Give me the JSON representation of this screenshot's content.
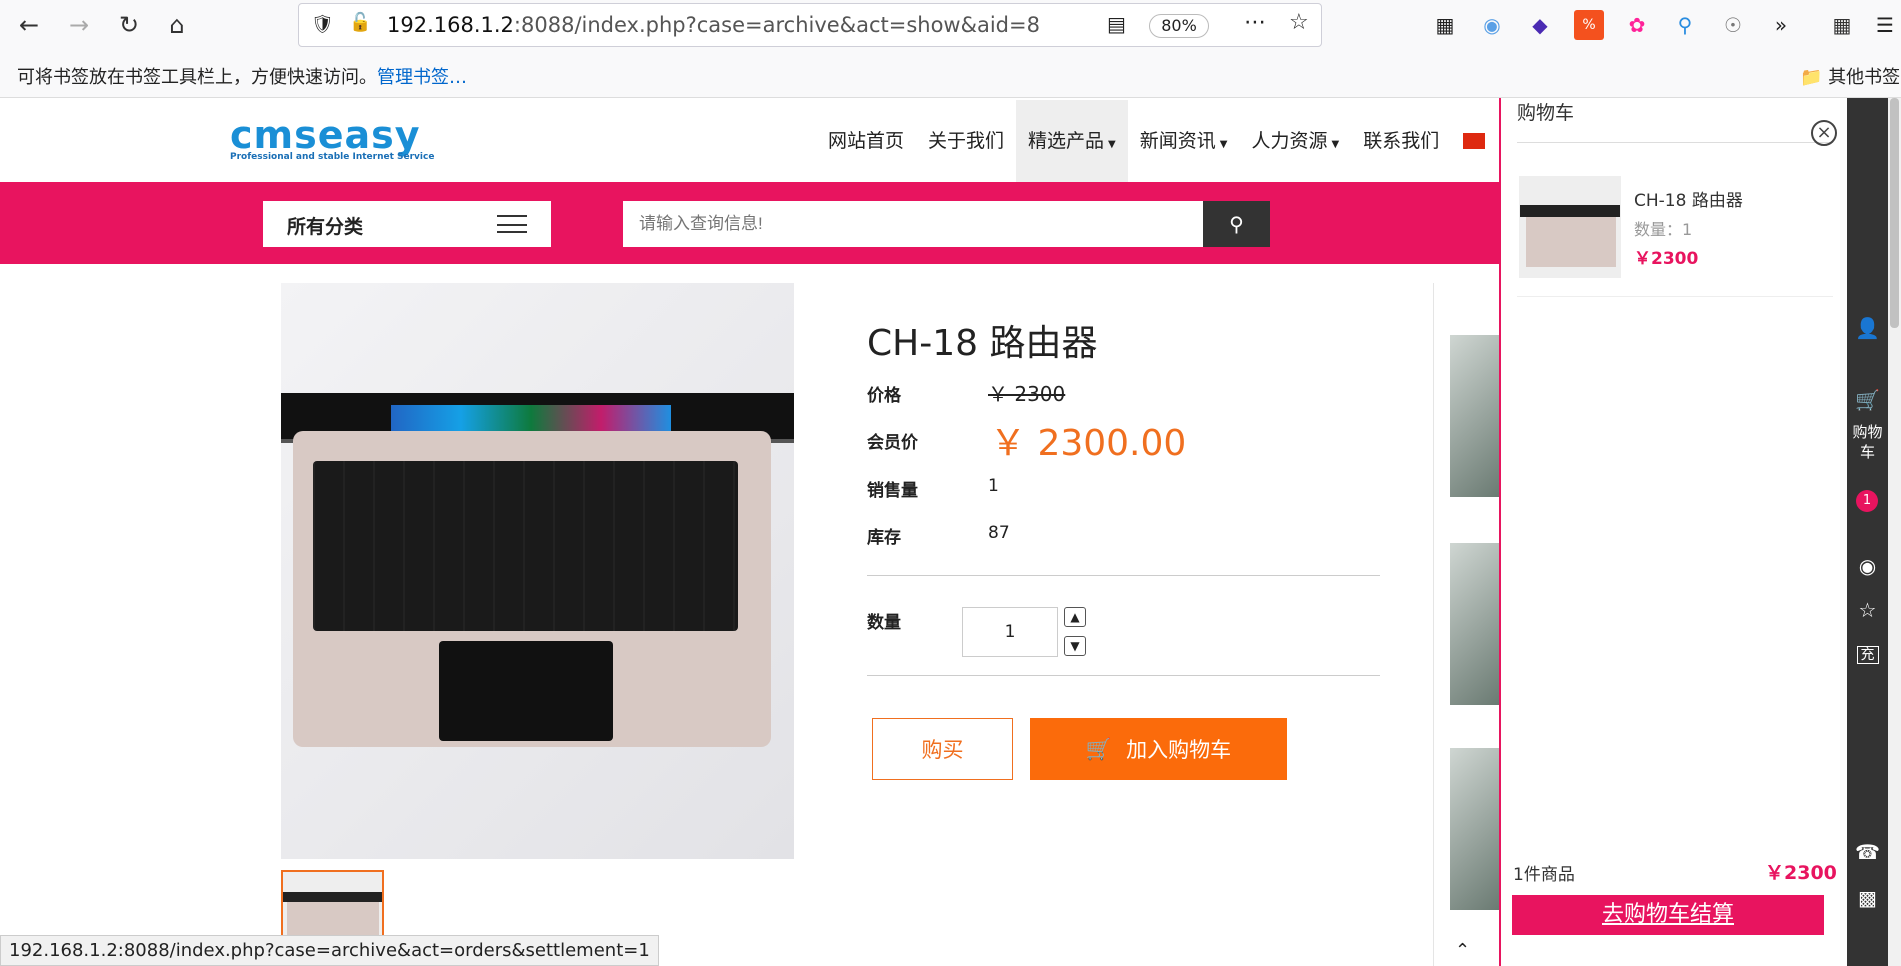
{
  "browser": {
    "url_host": "192.168.1.2",
    "url_rest": ":8088/index.php?case=archive&act=show&aid=8",
    "zoom": "80%",
    "bookmarks_hint": "可将书签放在书签工具栏上，方便快速访问。",
    "bookmarks_manage": "管理书签…",
    "other_bookmarks": "其他书签",
    "status_url": "192.168.1.2:8088/index.php?case=archive&act=orders&settlement=1"
  },
  "site": {
    "logo_main": "cmseasy",
    "logo_sub": "Professional and stable Internet Service",
    "nav": [
      {
        "label": "网站首页",
        "dropdown": false
      },
      {
        "label": "关于我们",
        "dropdown": false
      },
      {
        "label": "精选产品",
        "dropdown": true
      },
      {
        "label": "新闻资讯",
        "dropdown": true
      },
      {
        "label": "人力资源",
        "dropdown": true
      },
      {
        "label": "联系我们",
        "dropdown": false
      }
    ],
    "category_label": "所有分类",
    "search_placeholder": "请输入查询信息!"
  },
  "product": {
    "title": "CH-18 路由器",
    "price_label": "价格",
    "price_value": "￥ 2300",
    "member_label": "会员价",
    "member_value": "￥ 2300.00",
    "sales_label": "销售量",
    "sales_value": "1",
    "stock_label": "库存",
    "stock_value": "87",
    "qty_label": "数量",
    "qty_value": "1",
    "buy_label": "购买",
    "add_cart_label": "加入购物车"
  },
  "cart": {
    "title": "购物车",
    "item_name": "CH-18 路由器",
    "item_qty": "数量：1",
    "item_price": "￥2300",
    "total_count": "1件商品",
    "total_price": "￥2300",
    "checkout_label": "去购物车结算"
  },
  "rail": {
    "cart_label": "购物车",
    "badge": "1",
    "recharge": "充"
  },
  "colors": {
    "brand_pink": "#e8145f",
    "accent_orange": "#fb6b0b"
  }
}
